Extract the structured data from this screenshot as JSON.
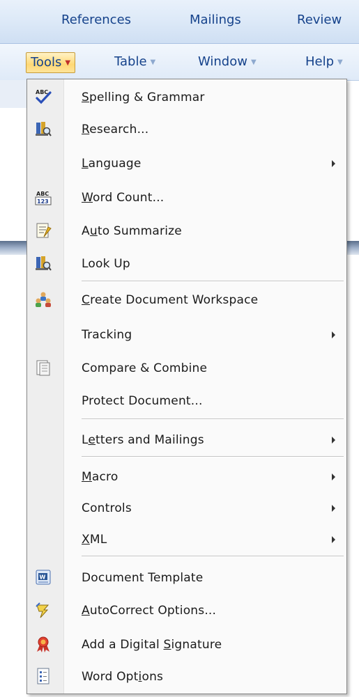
{
  "ribbon_tabs": [
    "References",
    "Mailings",
    "Review"
  ],
  "menu_bar": {
    "tools": "Tools",
    "table": "Table",
    "window": "Window",
    "help": "Help"
  },
  "tools_menu": {
    "items": [
      {
        "pre": "",
        "u": "S",
        "post": "pelling & Grammar",
        "icon": "spelling-abc-check-icon",
        "submenu": false
      },
      {
        "pre": "",
        "u": "R",
        "post": "esearch...",
        "icon": "research-books-icon",
        "submenu": false
      },
      {
        "pre": "",
        "u": "L",
        "post": "anguage",
        "icon": "",
        "submenu": true
      },
      {
        "pre": "",
        "u": "W",
        "post": "ord Count...",
        "icon": "word-count-abc123-icon",
        "submenu": false
      },
      {
        "pre": "A",
        "u": "u",
        "post": "to Summarize",
        "icon": "auto-summarize-icon",
        "submenu": false
      },
      {
        "pre": "Look Up",
        "u": "",
        "post": "",
        "icon": "lookup-books-icon",
        "submenu": false
      },
      {
        "pre": "",
        "u": "C",
        "post": "reate Document Workspace",
        "icon": "document-workspace-people-icon",
        "submenu": false
      },
      {
        "pre": "Tracking",
        "u": "",
        "post": "",
        "icon": "",
        "submenu": true
      },
      {
        "pre": "Compare & Combine",
        "u": "",
        "post": "",
        "icon": "compare-document-icon",
        "submenu": false
      },
      {
        "pre": "Protect Document...",
        "u": "",
        "post": "",
        "icon": "",
        "submenu": false
      },
      {
        "pre": "L",
        "u": "e",
        "post": "tters and Mailings",
        "icon": "",
        "submenu": true
      },
      {
        "pre": "",
        "u": "M",
        "post": "acro",
        "icon": "",
        "submenu": true
      },
      {
        "pre": "Controls",
        "u": "",
        "post": "",
        "icon": "",
        "submenu": true
      },
      {
        "pre": "",
        "u": "X",
        "post": "ML",
        "icon": "",
        "submenu": true
      },
      {
        "pre": "Document Template",
        "u": "",
        "post": "",
        "icon": "document-template-word-icon",
        "submenu": false
      },
      {
        "pre": "",
        "u": "A",
        "post": "utoCorrect Options...",
        "icon": "autocorrect-lightning-icon",
        "submenu": false
      },
      {
        "pre": "Add a Digital ",
        "u": "S",
        "post": "ignature",
        "icon": "digital-signature-ribbon-icon",
        "submenu": false
      },
      {
        "pre": "Word Opt",
        "u": "i",
        "post": "ons",
        "icon": "word-options-icon",
        "submenu": false
      }
    ]
  }
}
